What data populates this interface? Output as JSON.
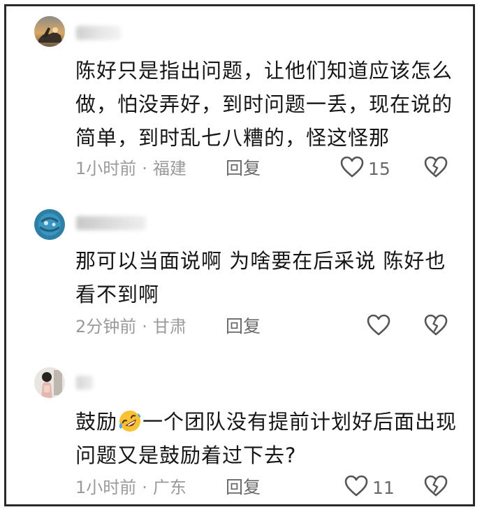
{
  "comments": [
    {
      "username": "",
      "text": "陈好只是指出问题，让他们知道应该怎么做，怕没弄好，到时问题一丢，现在说的简单，到时乱七八糟的，怪这怪那",
      "time": "1小时前",
      "separator": "·",
      "location": "福建",
      "reply_label": "回复",
      "likes": "15",
      "like_icon": "heart-outline-icon",
      "dislike_icon": "broken-heart-icon"
    },
    {
      "username": "",
      "text": "那可以当面说啊 为啥要在后采说 陈好也看不到啊",
      "time": "2分钟前",
      "separator": "·",
      "location": "甘肃",
      "reply_label": "回复",
      "likes": "",
      "like_icon": "heart-outline-icon",
      "dislike_icon": "broken-heart-icon"
    },
    {
      "username": "",
      "text_before_emoji": "鼓励",
      "emoji": "rolling-on-floor-laughing-emoji",
      "text_after_emoji": "一个团队没有提前计划好后面出现问题又是鼓励着过下去?",
      "time": "1小时前",
      "separator": "·",
      "location": "广东",
      "reply_label": "回复",
      "likes": "11",
      "like_icon": "heart-outline-icon",
      "dislike_icon": "broken-heart-icon"
    }
  ],
  "colors": {
    "text": "#161616",
    "meta": "#9a9a9a",
    "action": "#6a6a6a",
    "frame": "#2a2a2a"
  }
}
